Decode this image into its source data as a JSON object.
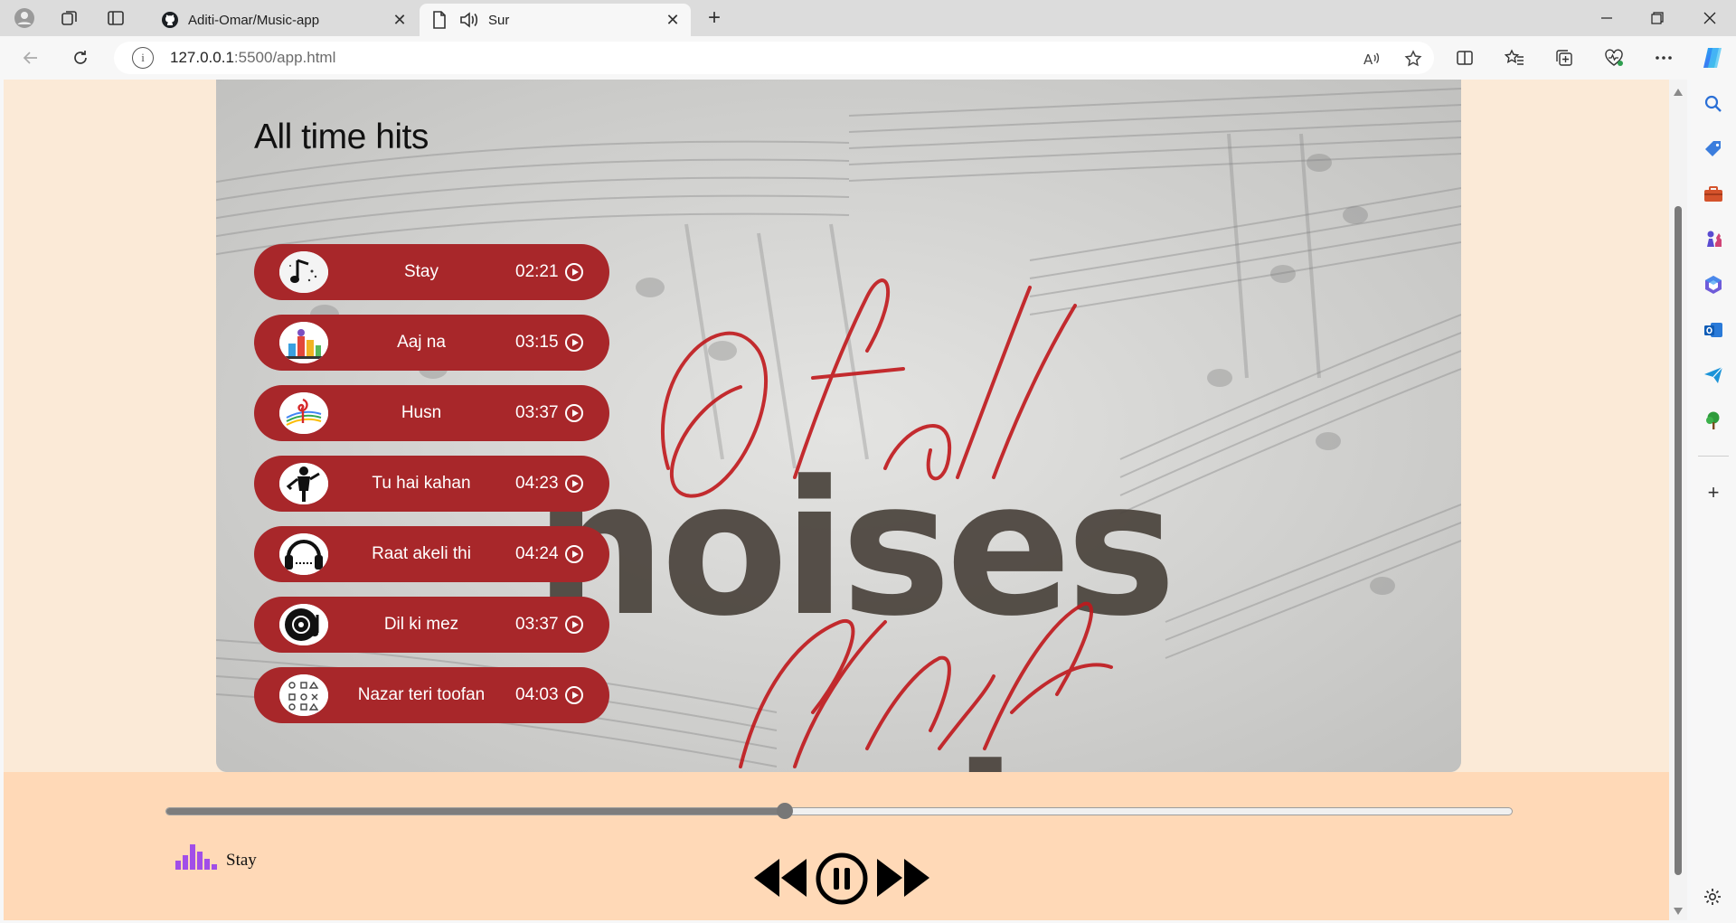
{
  "browser": {
    "tabs": [
      {
        "title": "Aditi-Omar/Music-app",
        "active": false
      },
      {
        "title": "Sur",
        "active": true,
        "audio": true
      }
    ],
    "url_host": "127.0.0.1",
    "url_rest": ":5500/app.html"
  },
  "page": {
    "heading": "All time hits",
    "songs": [
      {
        "name": "Stay",
        "duration": "02:21"
      },
      {
        "name": "Aaj na",
        "duration": "03:15"
      },
      {
        "name": "Husn",
        "duration": "03:37"
      },
      {
        "name": "Tu hai kahan",
        "duration": "04:23"
      },
      {
        "name": "Raat akeli thi",
        "duration": "04:24"
      },
      {
        "name": "Dil ki mez",
        "duration": "03:37"
      },
      {
        "name": "Nazar teri toofan",
        "duration": "04:03"
      }
    ]
  },
  "player": {
    "now_playing": "Stay",
    "progress": 0.46,
    "state": "playing"
  },
  "colors": {
    "page_bg": "#fbead7",
    "player_bg": "#ffd9b7",
    "song_item_bg": "#a8272a",
    "eq_accent": "#a14ee8"
  },
  "icons": {
    "song_play": "play-circle-icon",
    "previous": "previous-icon",
    "pause": "pause-circle-icon",
    "next": "next-icon"
  }
}
